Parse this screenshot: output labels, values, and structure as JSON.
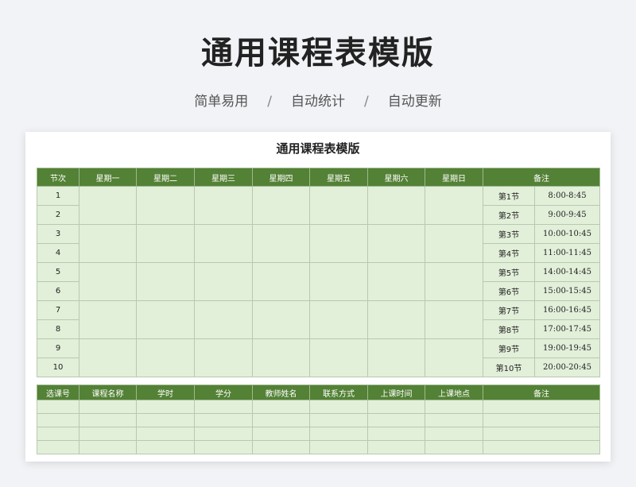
{
  "page": {
    "title": "通用课程表模版",
    "features": [
      "简单易用",
      "自动统计",
      "自动更新"
    ],
    "separator": "/"
  },
  "sheet": {
    "title": "通用课程表模版",
    "schedule": {
      "headers": [
        "节次",
        "星期一",
        "星期二",
        "星期三",
        "星期四",
        "星期五",
        "星期六",
        "星期日",
        "备注"
      ],
      "rows": [
        {
          "num": "1",
          "period": "第1节",
          "time": "8:00-8:45"
        },
        {
          "num": "2",
          "period": "第2节",
          "time": "9:00-9:45"
        },
        {
          "num": "3",
          "period": "第3节",
          "time": "10:00-10:45"
        },
        {
          "num": "4",
          "period": "第4节",
          "time": "11:00-11:45"
        },
        {
          "num": "5",
          "period": "第5节",
          "time": "14:00-14:45"
        },
        {
          "num": "6",
          "period": "第6节",
          "time": "15:00-15:45"
        },
        {
          "num": "7",
          "period": "第7节",
          "time": "16:00-16:45"
        },
        {
          "num": "8",
          "period": "第8节",
          "time": "17:00-17:45"
        },
        {
          "num": "9",
          "period": "第9节",
          "time": "19:00-19:45"
        },
        {
          "num": "10",
          "period": "第10节",
          "time": "20:00-20:45"
        }
      ]
    },
    "courses": {
      "headers": [
        "选课号",
        "课程名称",
        "学时",
        "学分",
        "教师姓名",
        "联系方式",
        "上课时间",
        "上课地点",
        "备注"
      ],
      "empty_rows": 4
    }
  }
}
